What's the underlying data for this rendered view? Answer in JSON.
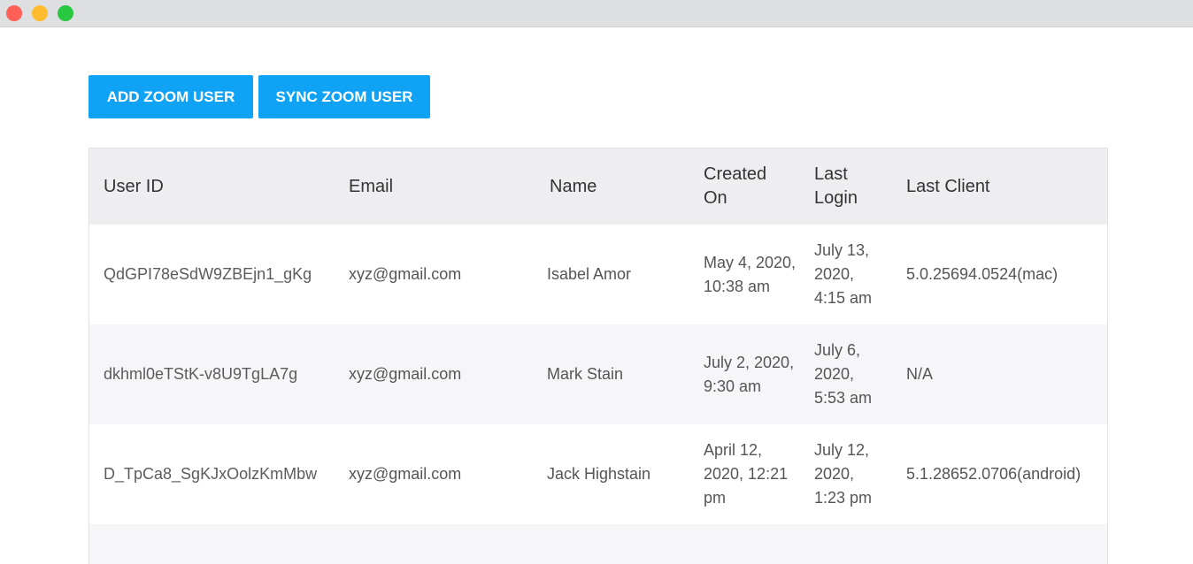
{
  "window": {
    "controls": [
      "close",
      "minimize",
      "maximize"
    ]
  },
  "toolbar": {
    "add_label": "ADD ZOOM USER",
    "sync_label": "SYNC ZOOM USER"
  },
  "table": {
    "headers": {
      "user_id": "User ID",
      "email": "Email",
      "name": "Name",
      "created_on": "Created On",
      "last_login": "Last Login",
      "last_client": "Last Client"
    },
    "rows": [
      {
        "user_id": "QdGPI78eSdW9ZBEjn1_gKg",
        "email": "xyz@gmail.com",
        "name": "Isabel Amor",
        "created_on": "May 4, 2020, 10:38 am",
        "last_login": "July 13, 2020, 4:15 am",
        "last_client": "5.0.25694.0524(mac)"
      },
      {
        "user_id": "dkhml0eTStK-v8U9TgLA7g",
        "email": "xyz@gmail.com",
        "name": "Mark Stain",
        "created_on": "July 2, 2020, 9:30 am",
        "last_login": "July 6, 2020, 5:53 am",
        "last_client": "N/A"
      },
      {
        "user_id": "D_TpCa8_SgKJxOolzKmMbw",
        "email": "xyz@gmail.com",
        "name": "Jack Highstain",
        "created_on": "April 12, 2020, 12:21 pm",
        "last_login": "July 12, 2020, 1:23 pm",
        "last_client": "5.1.28652.0706(android)"
      }
    ]
  },
  "colors": {
    "accent": "#10a2f5",
    "header_bg": "#eeeef1",
    "row_alt_bg": "#f6f6f8"
  }
}
